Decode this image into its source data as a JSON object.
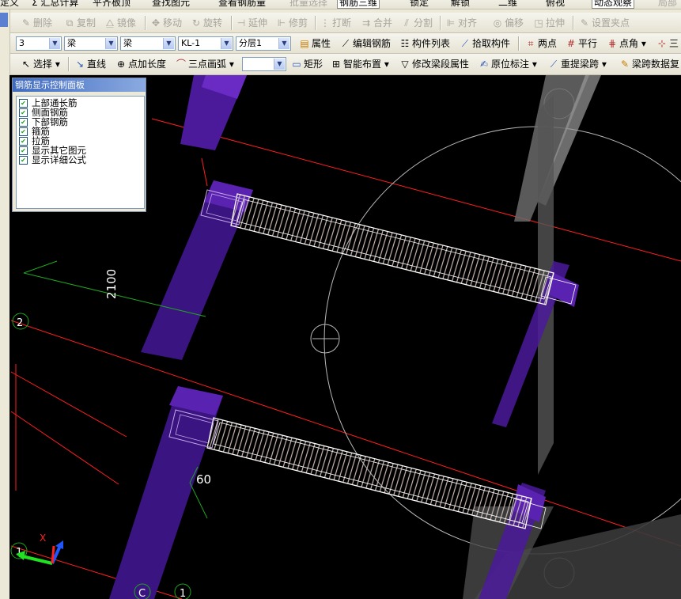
{
  "toolbar_top": {
    "items": [
      "定义",
      "Σ 汇总计算",
      "平齐板顶",
      "查找图元",
      "查看钢筋量",
      "批量选择",
      "钢筋三维",
      "锁定",
      "解锁",
      "二维",
      "俯视",
      "动态观察",
      "局部"
    ]
  },
  "toolbar_edit": {
    "items": [
      "删除",
      "复制",
      "镜像",
      "移动",
      "旋转",
      "延伸",
      "修剪",
      "打断",
      "合并",
      "分割",
      "对齐",
      "偏移",
      "拉伸",
      "设置夹点"
    ]
  },
  "toolbar_props": {
    "combo_floor": "3",
    "combo_type1": "梁",
    "combo_type2": "梁",
    "combo_name": "KL-1",
    "combo_layer": "分层1",
    "items": [
      "属性",
      "编辑钢筋",
      "构件列表",
      "拾取构件",
      "两点",
      "平行",
      "点角",
      "三"
    ]
  },
  "toolbar_draw": {
    "items": [
      "选择",
      "直线",
      "点加长度",
      "三点画弧",
      "矩形",
      "智能布置",
      "修改梁段属性",
      "原位标注",
      "重提梁跨",
      "梁跨数据复"
    ],
    "combo_blank": ""
  },
  "panel": {
    "title": "钢筋显示控制面板",
    "items": [
      {
        "label": "上部通长筋",
        "checked": true
      },
      {
        "label": "侧面钢筋",
        "checked": true
      },
      {
        "label": "下部钢筋",
        "checked": true
      },
      {
        "label": "箍筋",
        "checked": true
      },
      {
        "label": "拉筋",
        "checked": true
      },
      {
        "label": "显示其它图元",
        "checked": true
      },
      {
        "label": "显示详细公式",
        "checked": true
      }
    ]
  },
  "canvas": {
    "dimension_label": "2100",
    "angle_label": "60",
    "axis_2": "2",
    "axis_1_left": "1",
    "axis_c": "C",
    "axis_1_bottom": "1",
    "axis_x": "X",
    "colors": {
      "background": "#000000",
      "grid_line": "#ff1e1e",
      "column": "#4a1a9a",
      "stirrup": "#c8b8b0",
      "beam_outline": "#ffffff",
      "axis_circle": "#1fa51f"
    }
  }
}
